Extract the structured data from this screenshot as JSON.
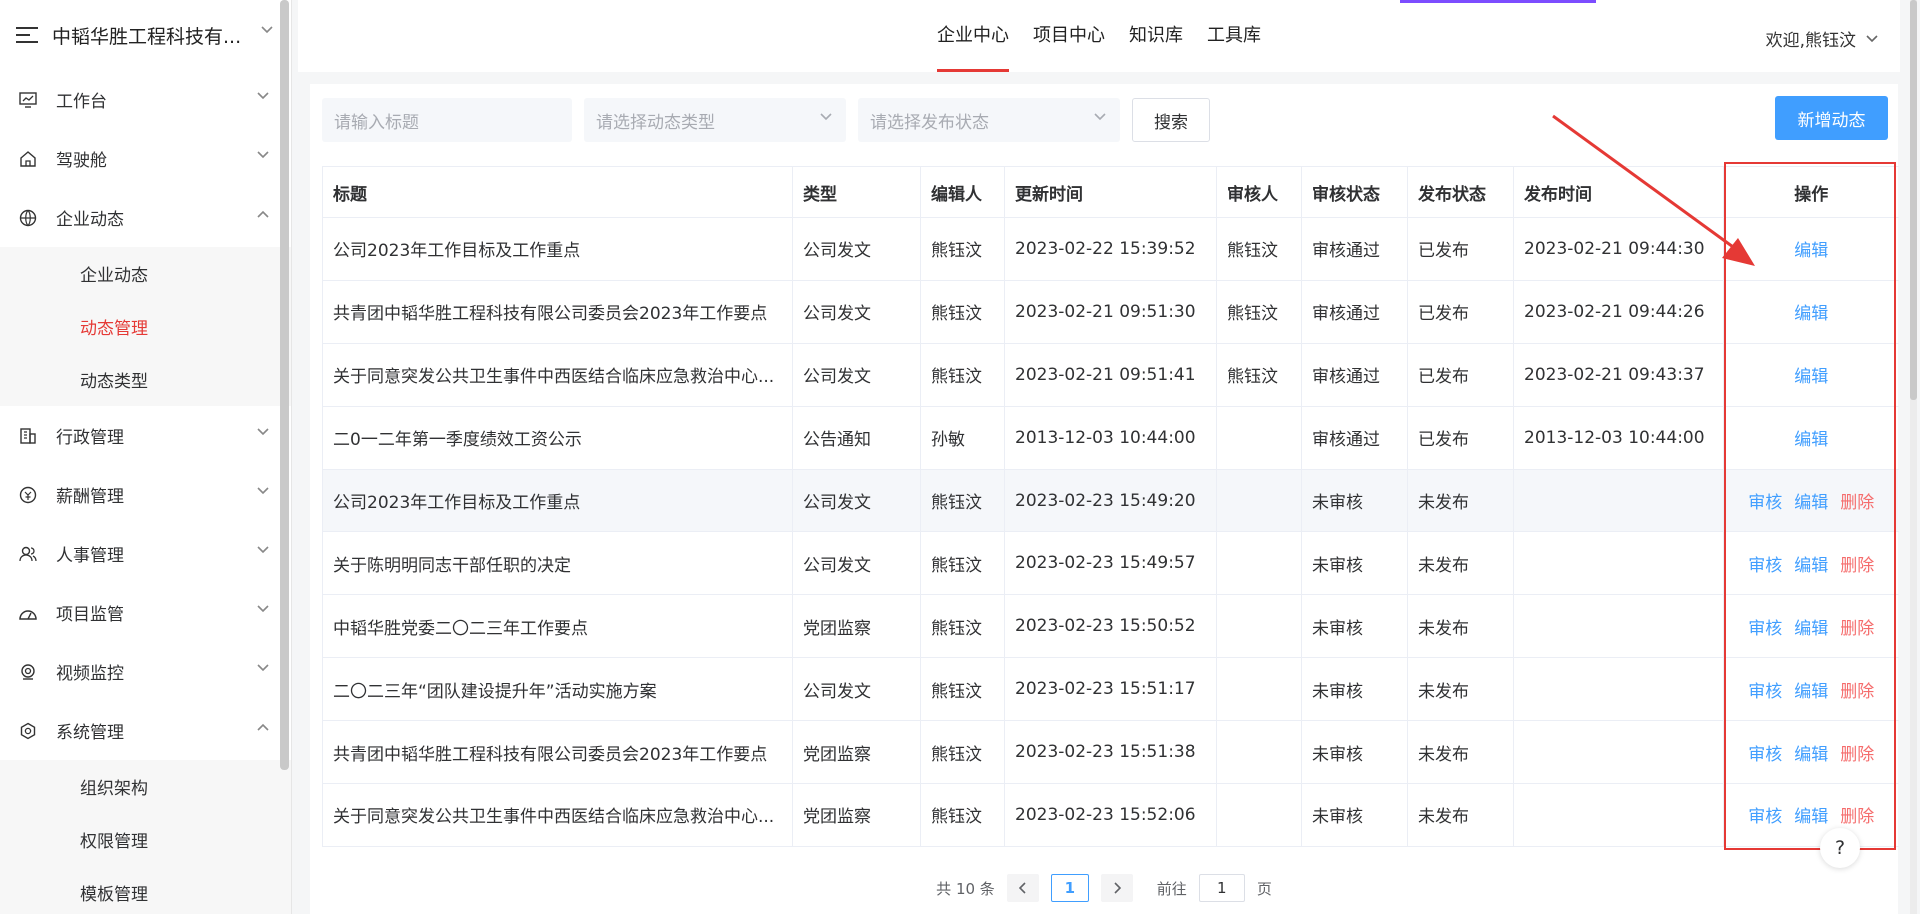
{
  "sidebar": {
    "brand": "中韬华胜工程科技有...",
    "items": [
      {
        "label": "工作台",
        "icon": "monitor-icon"
      },
      {
        "label": "驾驶舱",
        "icon": "home-icon"
      },
      {
        "label": "企业动态",
        "icon": "globe-icon",
        "expanded": true,
        "children": [
          "企业动态",
          "动态管理",
          "动态类型"
        ],
        "active_child": "动态管理"
      },
      {
        "label": "行政管理",
        "icon": "building-icon"
      },
      {
        "label": "薪酬管理",
        "icon": "wallet-icon"
      },
      {
        "label": "人事管理",
        "icon": "users-icon"
      },
      {
        "label": "项目监管",
        "icon": "dashboard-icon"
      },
      {
        "label": "视频监控",
        "icon": "location-icon"
      },
      {
        "label": "系统管理",
        "icon": "settings-icon",
        "expanded": true,
        "children": [
          "组织架构",
          "权限管理",
          "模板管理"
        ]
      }
    ]
  },
  "nav": {
    "tabs": [
      "企业中心",
      "项目中心",
      "知识库",
      "工具库"
    ],
    "active": "企业中心",
    "welcome": "欢迎,熊钰汶"
  },
  "filters": {
    "title_placeholder": "请输入标题",
    "type_placeholder": "请选择动态类型",
    "status_placeholder": "请选择发布状态",
    "search_label": "搜索",
    "add_label": "新增动态"
  },
  "table": {
    "headers": [
      "标题",
      "类型",
      "编辑人",
      "更新时间",
      "审核人",
      "审核状态",
      "发布状态",
      "发布时间",
      "操作"
    ],
    "actions": {
      "review": "审核",
      "edit": "编辑",
      "delete": "删除"
    },
    "rows": [
      {
        "title": "公司2023年工作目标及工作重点",
        "type": "公司发文",
        "editor": "熊钰汶",
        "updated": "2023-02-22 15:39:52",
        "reviewer": "熊钰汶",
        "review_status": "审核通过",
        "publish_status": "已发布",
        "published": "2023-02-21 09:44:30",
        "ops": [
          "edit"
        ]
      },
      {
        "title": "共青团中韬华胜工程科技有限公司委员会2023年工作要点",
        "type": "公司发文",
        "editor": "熊钰汶",
        "updated": "2023-02-21 09:51:30",
        "reviewer": "熊钰汶",
        "review_status": "审核通过",
        "publish_status": "已发布",
        "published": "2023-02-21 09:44:26",
        "ops": [
          "edit"
        ]
      },
      {
        "title": "关于同意突发公共卫生事件中西医结合临床应急救治中心...",
        "type": "公司发文",
        "editor": "熊钰汶",
        "updated": "2023-02-21 09:51:41",
        "reviewer": "熊钰汶",
        "review_status": "审核通过",
        "publish_status": "已发布",
        "published": "2023-02-21 09:43:37",
        "ops": [
          "edit"
        ]
      },
      {
        "title": "二0一二年第一季度绩效工资公示",
        "type": "公告通知",
        "editor": "孙敏",
        "updated": "2013-12-03 10:44:00",
        "reviewer": "",
        "review_status": "审核通过",
        "publish_status": "已发布",
        "published": "2013-12-03 10:44:00",
        "ops": [
          "edit"
        ]
      },
      {
        "title": "公司2023年工作目标及工作重点",
        "type": "公司发文",
        "editor": "熊钰汶",
        "updated": "2023-02-23 15:49:20",
        "reviewer": "",
        "review_status": "未审核",
        "publish_status": "未发布",
        "published": "",
        "ops": [
          "review",
          "edit",
          "delete"
        ],
        "hover": true
      },
      {
        "title": "关于陈明明同志干部任职的决定",
        "type": "公司发文",
        "editor": "熊钰汶",
        "updated": "2023-02-23 15:49:57",
        "reviewer": "",
        "review_status": "未审核",
        "publish_status": "未发布",
        "published": "",
        "ops": [
          "review",
          "edit",
          "delete"
        ]
      },
      {
        "title": "中韬华胜党委二〇二三年工作要点",
        "type": "党团监察",
        "editor": "熊钰汶",
        "updated": "2023-02-23 15:50:52",
        "reviewer": "",
        "review_status": "未审核",
        "publish_status": "未发布",
        "published": "",
        "ops": [
          "review",
          "edit",
          "delete"
        ]
      },
      {
        "title": "二〇二三年“团队建设提升年”活动实施方案",
        "type": "公司发文",
        "editor": "熊钰汶",
        "updated": "2023-02-23 15:51:17",
        "reviewer": "",
        "review_status": "未审核",
        "publish_status": "未发布",
        "published": "",
        "ops": [
          "review",
          "edit",
          "delete"
        ]
      },
      {
        "title": "共青团中韬华胜工程科技有限公司委员会2023年工作要点",
        "type": "党团监察",
        "editor": "熊钰汶",
        "updated": "2023-02-23 15:51:38",
        "reviewer": "",
        "review_status": "未审核",
        "publish_status": "未发布",
        "published": "",
        "ops": [
          "review",
          "edit",
          "delete"
        ]
      },
      {
        "title": "关于同意突发公共卫生事件中西医结合临床应急救治中心...",
        "type": "党团监察",
        "editor": "熊钰汶",
        "updated": "2023-02-23 15:52:06",
        "reviewer": "",
        "review_status": "未审核",
        "publish_status": "未发布",
        "published": "",
        "ops": [
          "review",
          "edit",
          "delete"
        ]
      }
    ]
  },
  "pagination": {
    "total_text": "共 10 条",
    "current_page": "1",
    "goto_prefix": "前往",
    "goto_value": "1",
    "goto_suffix": "页"
  },
  "help": "?",
  "colors": {
    "primary": "#409eff",
    "danger": "#f56c6c",
    "accent": "#e53935",
    "annotation": "#e53935"
  }
}
